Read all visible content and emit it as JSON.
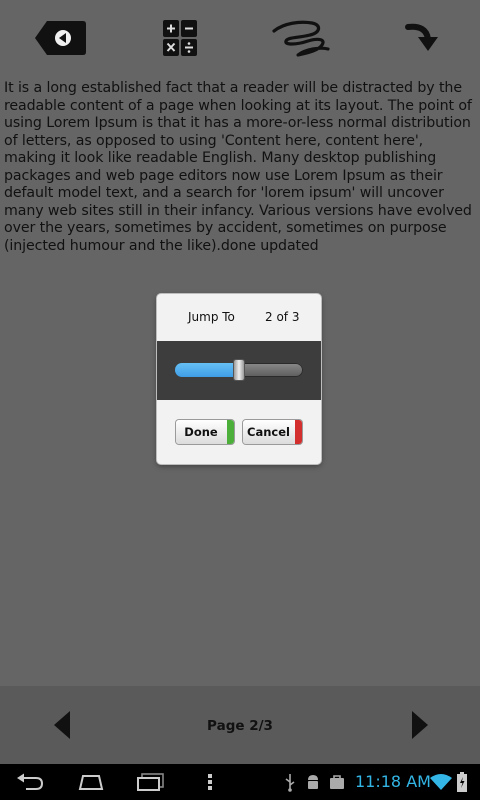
{
  "toolbar": {
    "icons": [
      "back-label-icon",
      "calculator-icon",
      "signature-icon",
      "redo-arrow-icon"
    ]
  },
  "document": {
    "text": "It is a long established fact that a reader will be distracted by the readable content of a page when looking at its layout. The point of using Lorem Ipsum is that it has a more-or-less normal distribution of letters, as opposed to using 'Content here, content here', making it look like readable English. Many desktop publishing packages and web page editors now use Lorem Ipsum as their default model text, and a search for 'lorem ipsum' will uncover many web sites still in their infancy. Various versions have evolved over the years, sometimes by accident, sometimes on purpose (injected humour and the like).done updated"
  },
  "dialog": {
    "title": "Jump To",
    "count": "2 of 3",
    "slider_value": 0.5,
    "done_label": "Done",
    "cancel_label": "Cancel",
    "colors": {
      "fill": "#3f9de6",
      "done_stripe": "#4caf3a",
      "cancel_stripe": "#d32f2f"
    }
  },
  "bottom": {
    "page_label": "Page 2/3"
  },
  "status": {
    "time": "11:18 AM"
  }
}
